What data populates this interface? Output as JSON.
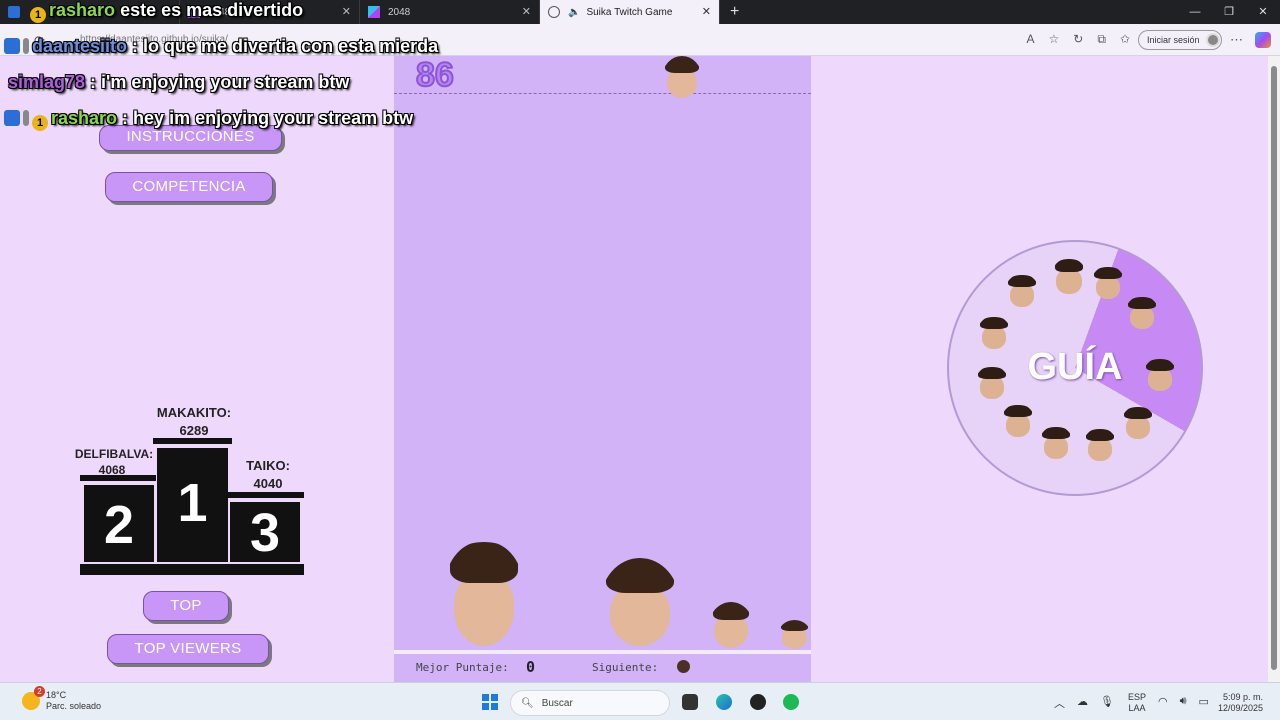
{
  "browser": {
    "tabs": [
      {
        "title": "",
        "active": false
      },
      {
        "title": "2048",
        "active": false
      },
      {
        "title": "2048",
        "active": false
      },
      {
        "title": "Suika Twitch Game",
        "active": true
      }
    ],
    "new_tab": "+",
    "url": "https://daantesiito.github.io/suika/",
    "signin_label": "Iniciar sesión"
  },
  "sidebar": {
    "instructions_label": "INSTRUCCIONES",
    "competition_label": "COMPETENCIA",
    "top_label": "TOP",
    "top_viewers_label": "TOP VIEWERS"
  },
  "podium": {
    "first": {
      "name": "MAKAKITO:",
      "score": "6289",
      "place": "1"
    },
    "second": {
      "name": "DELFIBALVA:",
      "score": "4068",
      "place": "2"
    },
    "third": {
      "name": "TAIKO:",
      "score": "4040",
      "place": "3"
    }
  },
  "game": {
    "score": "86",
    "best_label": "Mejor Puntaje:",
    "best_value": "0",
    "next_label": "Siguiente:"
  },
  "guide": {
    "title": "GUÍA"
  },
  "chat": [
    {
      "user": "rasharo",
      "message": "este es mas divertido",
      "user_color": "#8bd84a"
    },
    {
      "user": "daantesiito",
      "message": "lo que me divertia con esta mierda",
      "user_color": "#6f8fe0"
    },
    {
      "user": "simlag78",
      "message": "i'm enjoying your stream btw",
      "user_color": "#b05ee0"
    },
    {
      "user": "rasharo",
      "message": "hey im enjoying your stream btw",
      "user_color": "#8bd84a"
    }
  ],
  "taskbar": {
    "weather_temp": "18°C",
    "weather_desc": "Parc. soleado",
    "search_placeholder": "Buscar",
    "lang_top": "ESP",
    "lang_bottom": "LAA",
    "time": "5:09 p. m.",
    "date": "12/09/2025"
  },
  "colors": {
    "page_bg": "#eed9fc",
    "game_bg": "#d2b3f8",
    "button_bg": "#c796f7",
    "score_text": "#b784f3"
  }
}
